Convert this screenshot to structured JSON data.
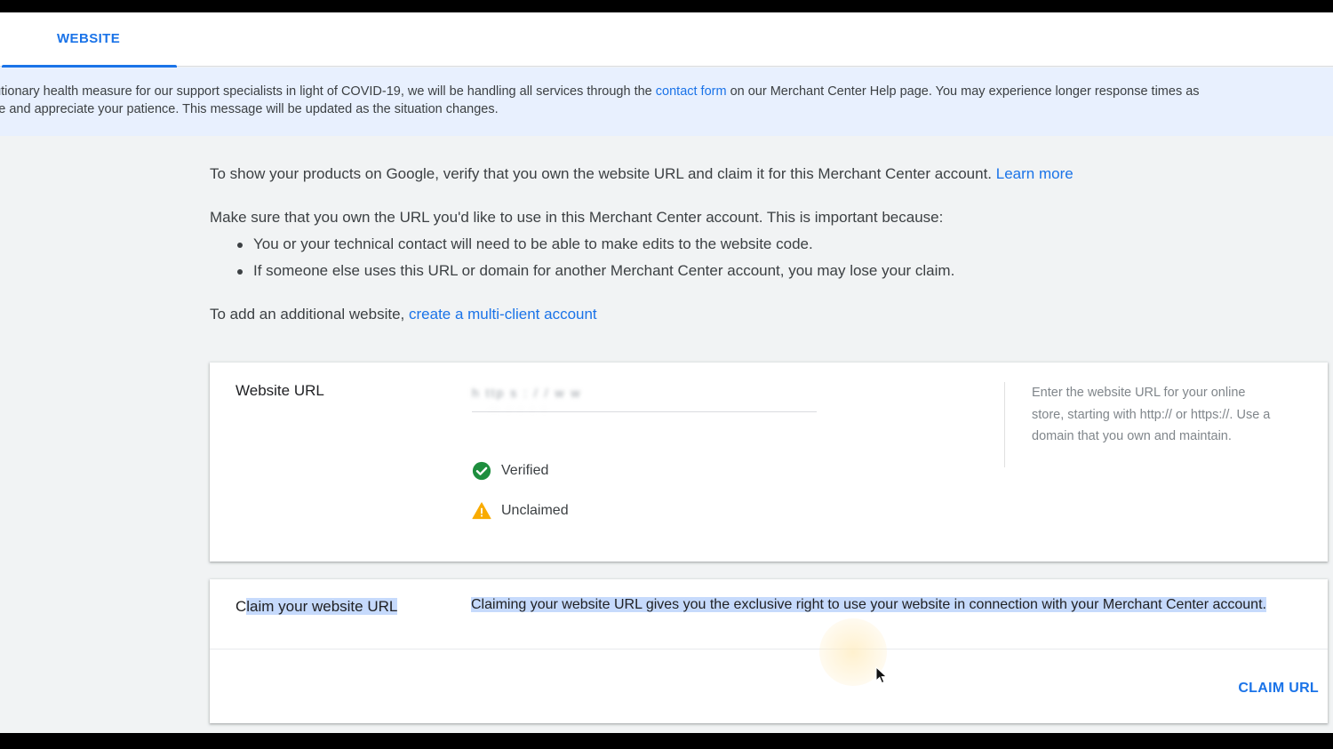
{
  "tabs": [
    {
      "label": "WEBSITE",
      "active": true
    }
  ],
  "notice": {
    "line1_prefix": "autionary health measure for our support specialists in light of COVID-19, we will be handling all services through the ",
    "line1_link": "contact form",
    "line1_suffix": " on our Merchant Center Help page. You may experience longer response times as",
    "line2": "se and appreciate your patience. This message will be updated as the situation changes."
  },
  "intro": {
    "p1_text": "To show your products on Google, verify that you own the website URL and claim it for this Merchant Center account. ",
    "p1_link": "Learn more",
    "p2_text": "Make sure that you own the URL you'd like to use in this Merchant Center account. This is important because:",
    "bullets": [
      "You or your technical contact will need to be able to make edits to the website code.",
      "If someone else uses this URL or domain for another Merchant Center account, you may lose your claim."
    ],
    "p3_text": "To add an additional website, ",
    "p3_link": "create a multi-client account"
  },
  "website_card": {
    "label": "Website URL",
    "url_value": "h ttp  s : / /   w w",
    "url_value_2": "   ..  .  .  .  .  ",
    "statuses": [
      {
        "label": "Verified",
        "icon": "check-circle-icon",
        "color": "#1e8e3e"
      },
      {
        "label": "Unclaimed",
        "icon": "warning-icon",
        "color": "#f9ab00"
      }
    ],
    "help_text": "Enter the website URL for your online store, starting with http:// or https://. Use a domain that you own and maintain."
  },
  "claim_card": {
    "label_pre": "C",
    "label_selected": "laim your website URL",
    "description": "Claiming your website URL gives you the exclusive right to use your website in connection with your Merchant Center account.",
    "button_label": "CLAIM URL"
  },
  "colors": {
    "accent": "#1a73e8",
    "selection": "#c6dafc",
    "notice_bg": "#e8f0fe"
  }
}
